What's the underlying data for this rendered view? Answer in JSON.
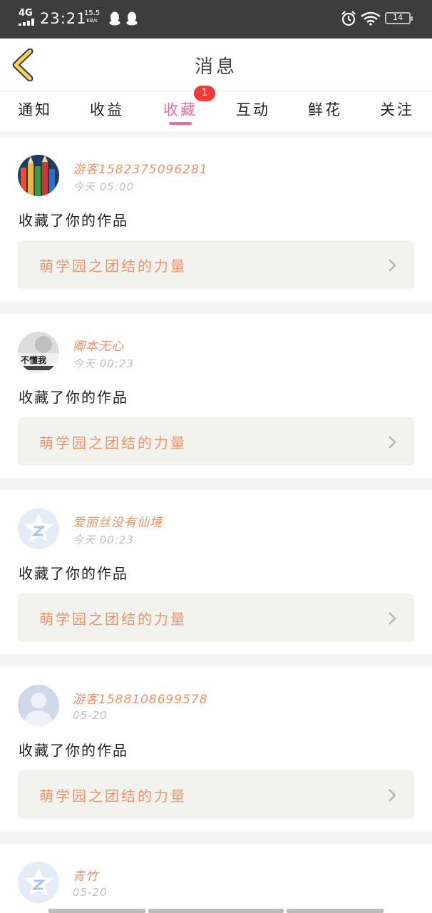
{
  "status_bar": {
    "network": "4G",
    "time": "23:21",
    "speed_value": "15.5",
    "speed_unit": "KB/s",
    "battery": "14"
  },
  "header": {
    "title": "消息",
    "back_icon": "chevron-left-icon"
  },
  "tabs": [
    {
      "label": "通知"
    },
    {
      "label": "收益"
    },
    {
      "label": "收藏",
      "active": true,
      "badge": "1"
    },
    {
      "label": "互动"
    },
    {
      "label": "鲜花"
    },
    {
      "label": "关注"
    }
  ],
  "messages": [
    {
      "user": "游客15823750962​81",
      "time": "今天 05:00",
      "action": "收藏了你的作品",
      "work": "萌学园之团结的力量",
      "avatar": "pencils-avatar"
    },
    {
      "user": "卿本无心",
      "time": "今天 00:23",
      "action": "收藏了你的作品",
      "work": "萌学园之团结的力量",
      "avatar": "photo-avatar",
      "avatar_text": "不懂我"
    },
    {
      "user": "爱丽丝没有仙境",
      "time": "今天 00:23",
      "action": "收藏了你的作品",
      "work": "萌学园之团结的力量",
      "avatar": "qzone-default-avatar"
    },
    {
      "user": "游客1588108699578",
      "time": "05-20",
      "action": "收藏了你的作品",
      "work": "萌学园之团结的力量",
      "avatar": "default-person-avatar"
    },
    {
      "user": "青竹",
      "time": "05-20",
      "action": "",
      "work": "",
      "avatar": "qzone-default-avatar"
    }
  ],
  "colors": {
    "accent": "#e070a6",
    "username": "#e8956b",
    "badge": "#ef3b3b",
    "statusbar": "#3d3d3d"
  }
}
